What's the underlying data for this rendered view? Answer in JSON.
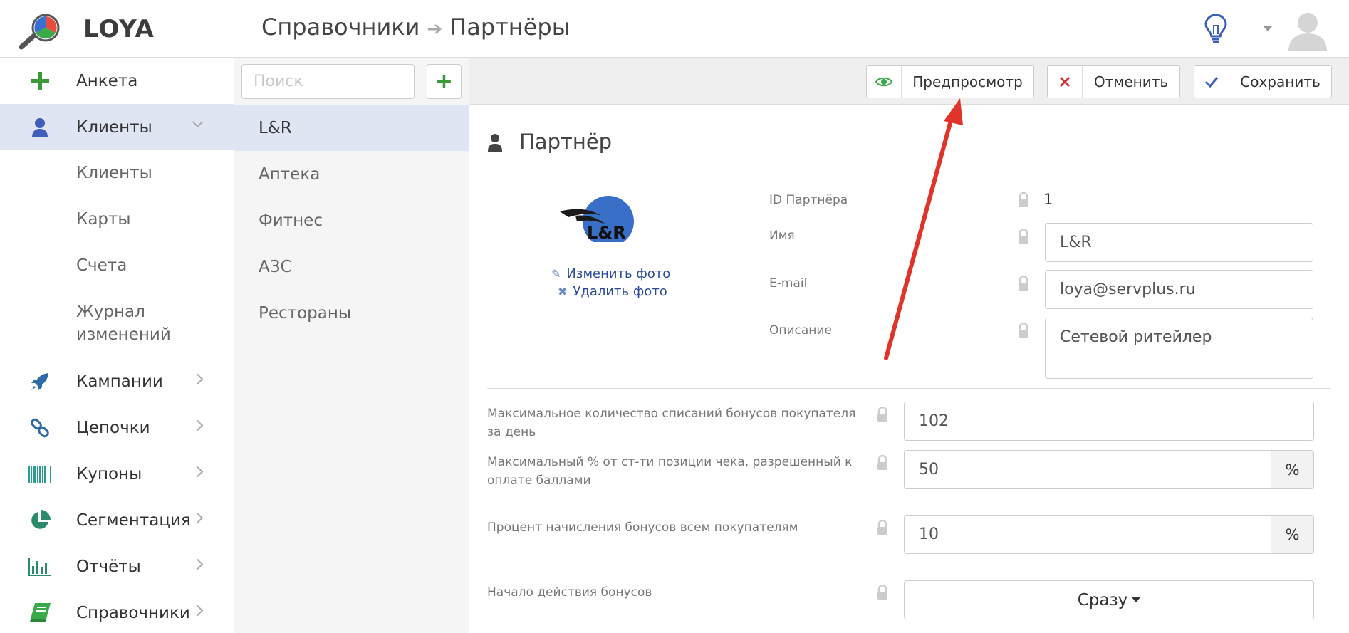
{
  "header": {
    "logo_text": "LOYA",
    "breadcrumb": [
      "Справочники",
      "Партнёры"
    ]
  },
  "sidebar": {
    "items": [
      {
        "label": "Анкета",
        "icon": "plus-icon"
      },
      {
        "label": "Клиенты",
        "icon": "user-icon",
        "active": true,
        "expanded": true
      },
      {
        "label": "Кампании",
        "icon": "rocket-icon"
      },
      {
        "label": "Цепочки",
        "icon": "link-icon"
      },
      {
        "label": "Купоны",
        "icon": "barcode-icon"
      },
      {
        "label": "Сегментация",
        "icon": "pie-chart-icon"
      },
      {
        "label": "Отчёты",
        "icon": "bar-chart-icon"
      },
      {
        "label": "Справочники",
        "icon": "book-icon"
      }
    ],
    "subitems": [
      "Клиенты",
      "Карты",
      "Счета",
      "Журнал",
      "изменений"
    ]
  },
  "list": {
    "search_placeholder": "Поиск",
    "add_label": "+",
    "items": [
      "L&R",
      "Аптека",
      "Фитнес",
      "АЗС",
      "Рестораны"
    ]
  },
  "toolbar": {
    "preview_label": "Предпросмотр",
    "cancel_label": "Отменить",
    "save_label": "Сохранить"
  },
  "partner": {
    "title": "Партнёр",
    "photo_text": "L&R",
    "change_photo": "Изменить фото",
    "delete_photo": "Удалить фото",
    "id_label": "ID Партнёра",
    "id_value": "1",
    "name_label": "Имя",
    "name_value": "L&R",
    "email_label": "E-mail",
    "email_value": "loya@servplus.ru",
    "desc_label": "Описание",
    "desc_value": "Сетевой ритейлер",
    "max_writeoffs_label": "Максимальное количество списаний бонусов покупателя за день",
    "max_writeoffs_value": "102",
    "max_percent_label": "Максимальный % от ст-ти позиции чека, разрешенный к оплате баллами",
    "max_percent_value": "50",
    "accrual_label": "Процент начисления бонусов всем покупателям",
    "accrual_value": "10",
    "percent_sign": "%",
    "start_label": "Начало действия бонусов",
    "start_value": "Сразу"
  },
  "colors": {
    "accent_blue": "#3f5fb8",
    "active_bg": "#dfe5f3",
    "green": "#3a9a3a",
    "red": "#d33333",
    "annotation_arrow": "#e0342a"
  }
}
